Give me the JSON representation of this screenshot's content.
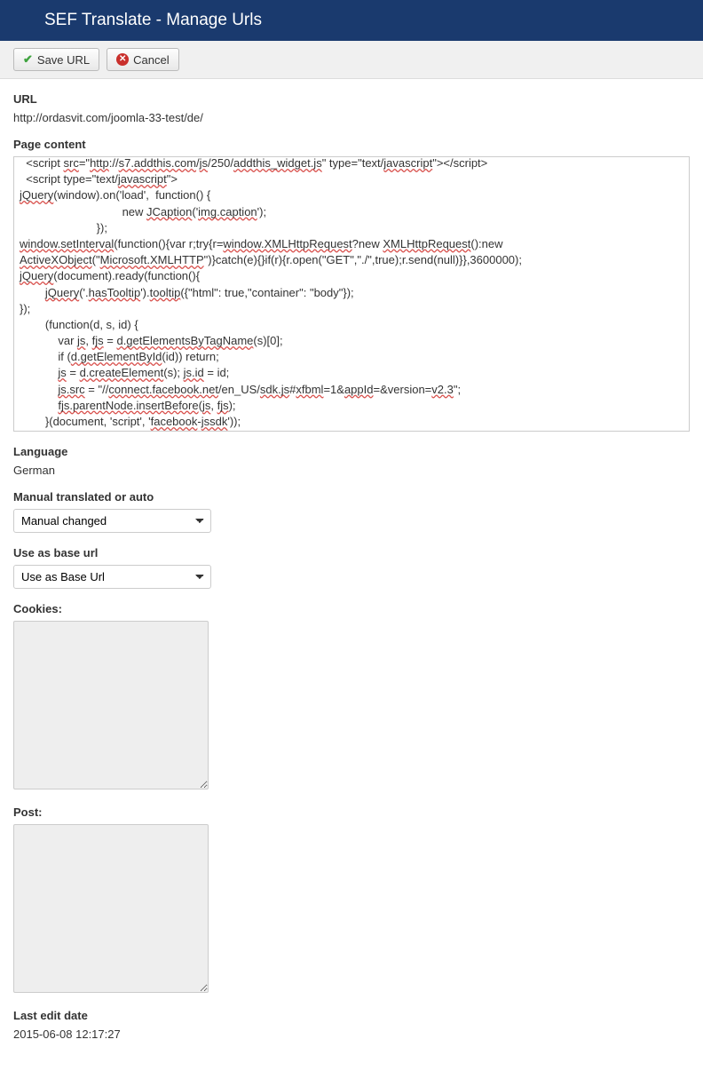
{
  "header": {
    "title": "SEF Translate - Manage Urls"
  },
  "toolbar": {
    "save_label": "Save URL",
    "cancel_label": "Cancel"
  },
  "form": {
    "url_label": "URL",
    "url_value": "http://ordasvit.com/joomla-33-test/de/",
    "page_content_label": "Page content",
    "page_content_html": "  &lt;script <span class='ul'>src</span>=\"<span class='ul'>http</span>://<span class='ul'>s7.addthis.com</span>/<span class='ul'>js</span>/250/<span class='ul'>addthis_widget.js</span>\" type=\"text/<span class='ul'>javascript</span>\"&gt;&lt;/script&gt;\n  &lt;script type=\"text/<span class='ul'>javascript</span>\"&gt;\n<span class='ul'>jQuery</span>(window).on('load',  function() {\n                                new <span class='ul'>JCaption</span>('<span class='ul'>img.caption</span>');\n                        });\n<span class='ul'>window.setInterval</span>(function(){var r;try{r=<span class='ul'>window.XMLHttpRequest</span>?new <span class='ul'>XMLHttpRequest</span>():new\n<span class='ul'>ActiveXObject</span>(\"<span class='ul'>Microsoft.XMLHTTP</span>\")}catch(e){}if(r){r.open(\"GET\",\"./\",true);r.send(null)}},3600000);\n<span class='ul'>jQuery</span>(document).ready(function(){\n        <span class='ul'>jQuery</span>('.<span class='ul'>hasTooltip</span>').<span class='ul'>tooltip</span>({\"html\": true,\"container\": \"body\"});\n});\n        (function(d, s, id) {\n            var <span class='ul'>js</span>, <span class='ul'>fjs</span> = <span class='ul'>d.getElementsByTagName</span>(s)[0];\n            if (<span class='ul'>d.getElementById</span>(id)) return;\n            <span class='ul'>js</span> = <span class='ul'>d.createElement</span>(s); <span class='ul'>js.id</span> = id;\n            <span class='ul'>js.src</span> = \"//<span class='ul'>connect.facebook.net</span>/en_US/<span class='ul'>sdk.js</span>#<span class='ul'>xfbml</span>=1&amp;<span class='ul'>appId</span>=&amp;version=<span class='ul'>v2.3</span>\";\n            <span class='ul'>fjs.parentNode.insertBefore</span>(<span class='ul'>js</span>, <span class='ul'>fjs</span>);\n        }(document, 'script', '<span class='ul'>facebook</span>-<span class='ul'>jssdk</span>'));\n  &lt;/script&gt;",
    "language_label": "Language",
    "language_value": "German",
    "manual_label": "Manual translated or auto",
    "manual_selected": "Manual changed",
    "baseurl_label": "Use as base url",
    "baseurl_selected": "Use as Base Url",
    "cookies_label": "Cookies:",
    "cookies_value": "",
    "post_label": "Post:",
    "post_value": "",
    "lastedit_label": "Last edit date",
    "lastedit_value": "2015-06-08 12:17:27"
  }
}
